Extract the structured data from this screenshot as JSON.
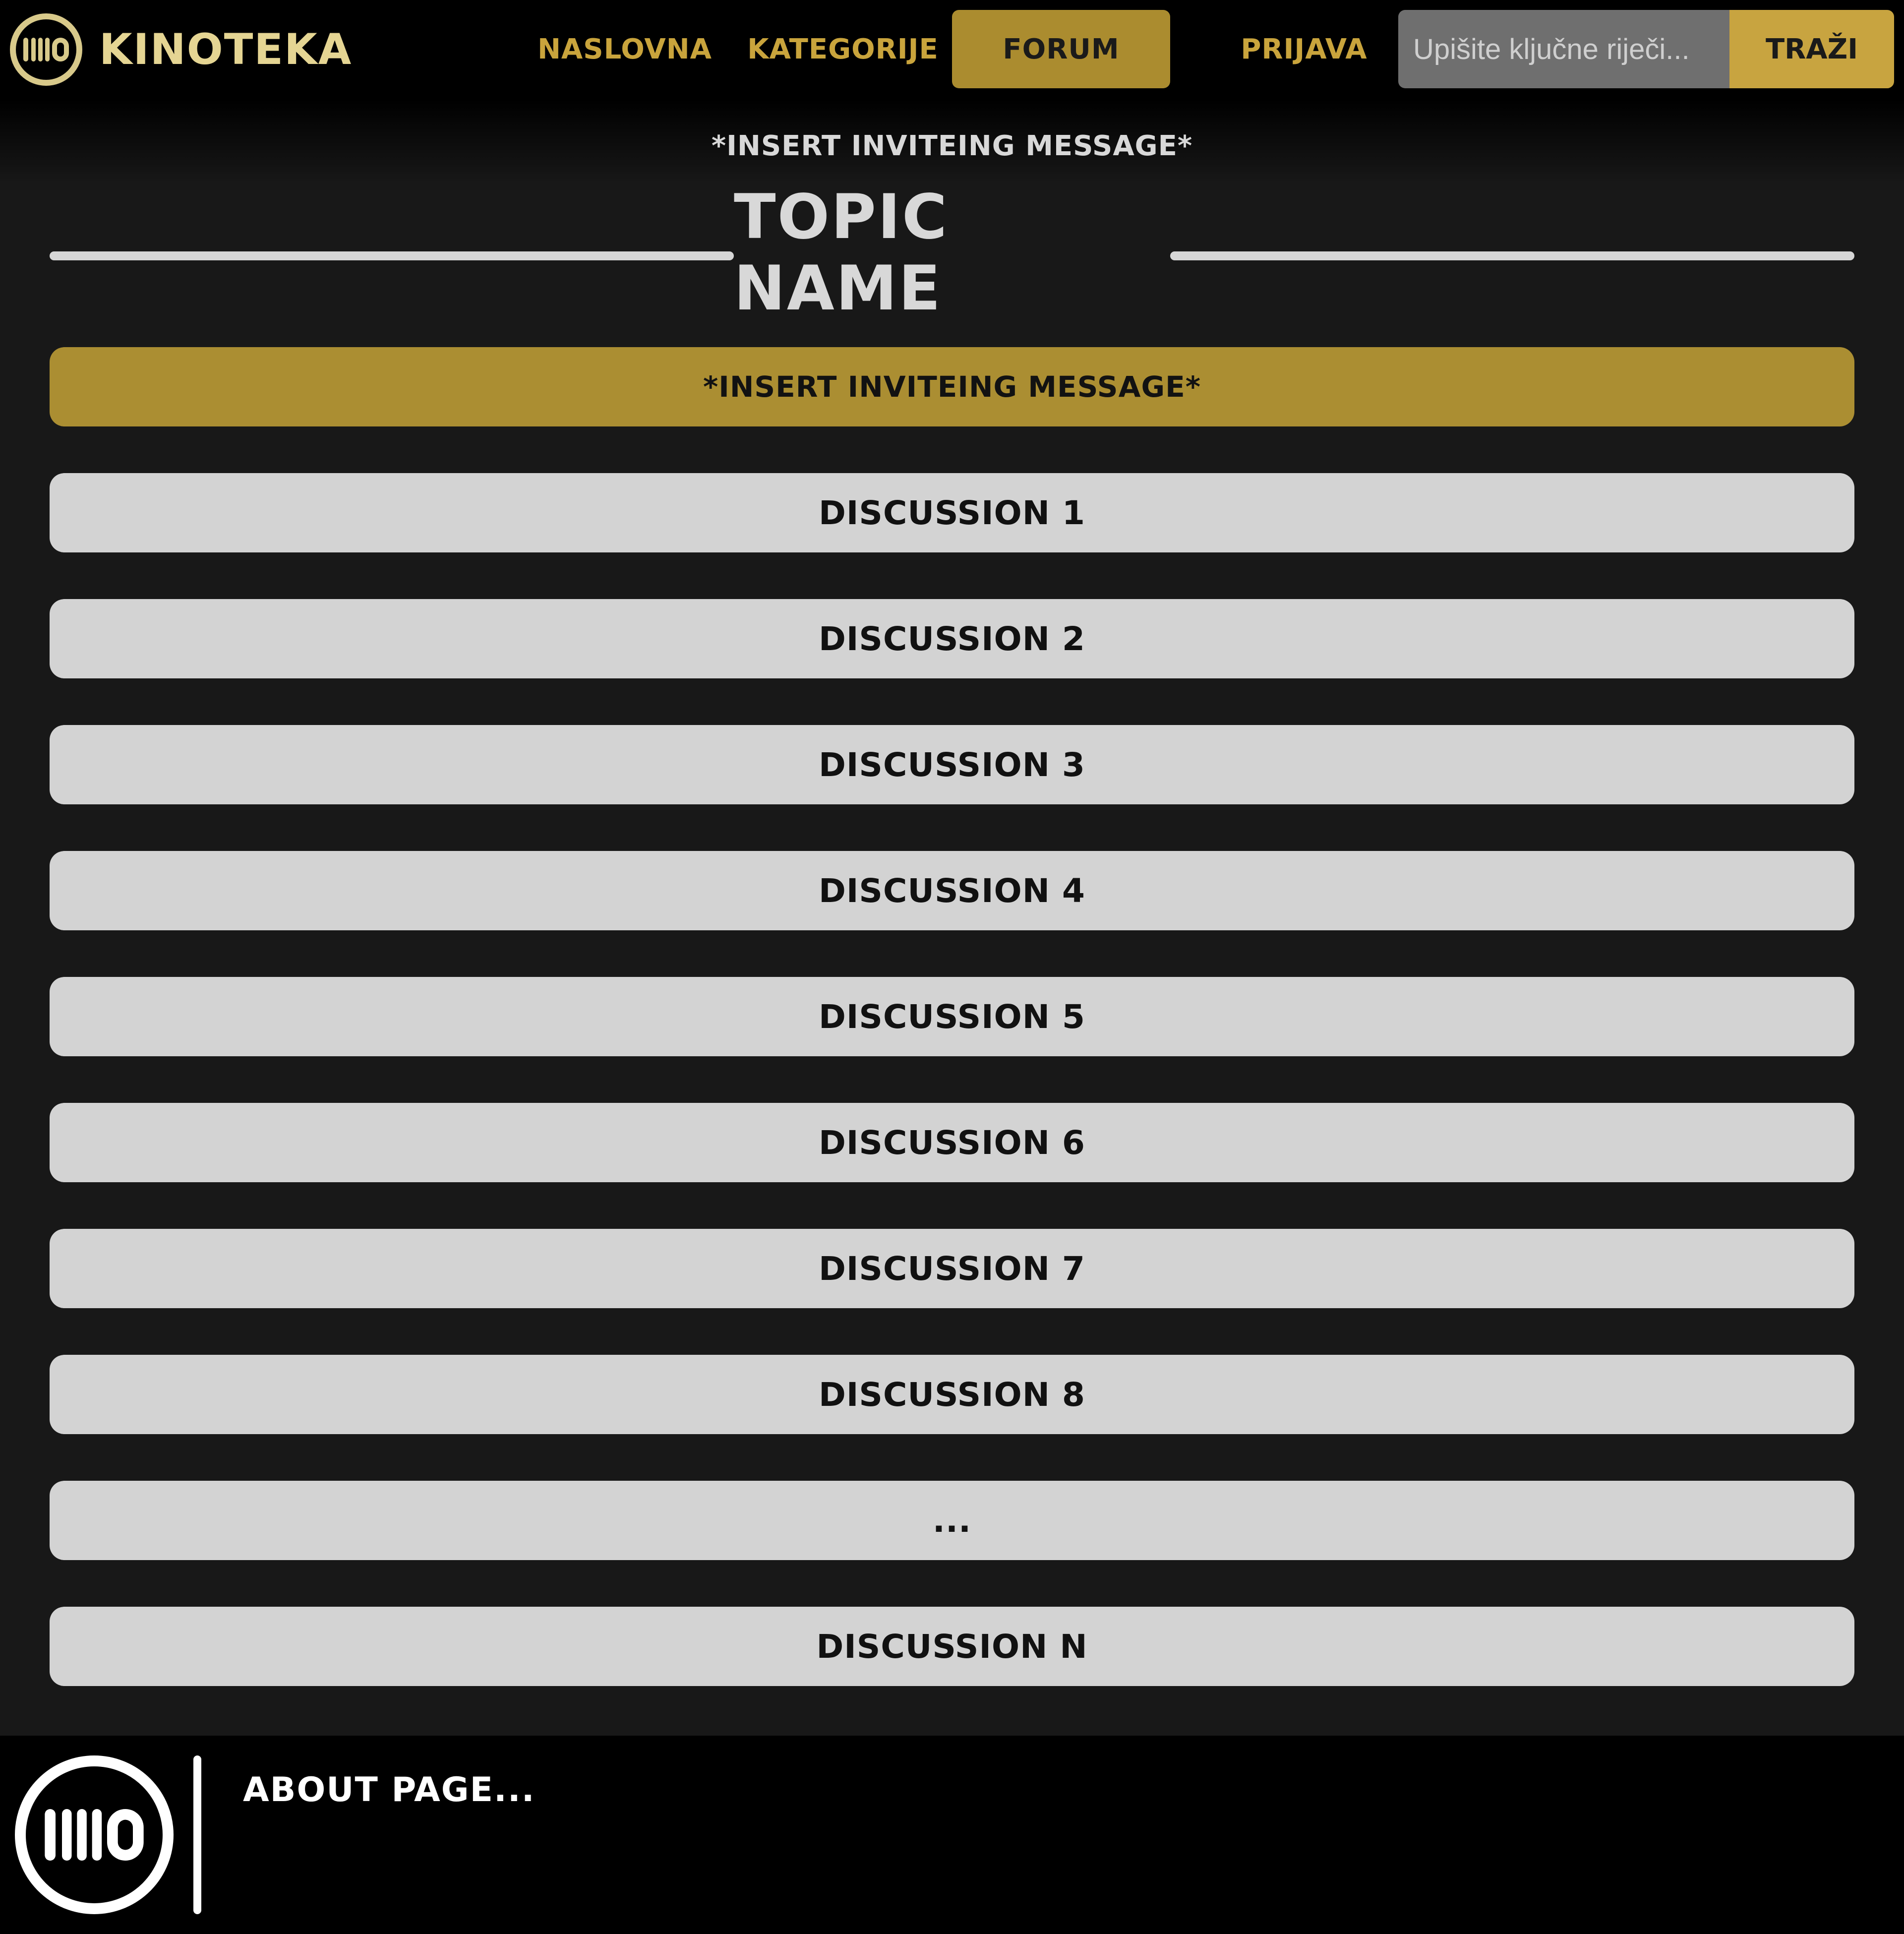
{
  "header": {
    "brand_name": "KINOTEKA",
    "logo_icon": "kino-logo-icon",
    "nav": {
      "home": "NASLOVNA",
      "categories": "KATEGORIJE",
      "forum": "FORUM",
      "login": "PRIJAVA"
    },
    "active_nav": "forum",
    "search": {
      "placeholder": "Upišite ključne riječi...",
      "value": "",
      "button_label": "TRAŽI"
    }
  },
  "main": {
    "invite_message": "*INSERT INVITEING MESSAGE*",
    "topic_title": "TOPIC NAME",
    "featured_message": "*INSERT INVITEING MESSAGE*",
    "discussions": [
      "DISCUSSION 1",
      "DISCUSSION 2",
      "DISCUSSION 3",
      "DISCUSSION 4",
      "DISCUSSION 5",
      "DISCUSSION 6",
      "DISCUSSION 7",
      "DISCUSSION 8",
      "...",
      "DISCUSSION N"
    ]
  },
  "footer": {
    "logo_icon": "kino-logo-icon",
    "about_text": "ABOUT PAGE..."
  },
  "colors": {
    "gold": "#c9a43c",
    "gold_dark": "#ab8e32",
    "brand_text": "#e5d593",
    "background": "#181818",
    "bar_background": "#000000",
    "item_background": "#d3d3d3"
  }
}
